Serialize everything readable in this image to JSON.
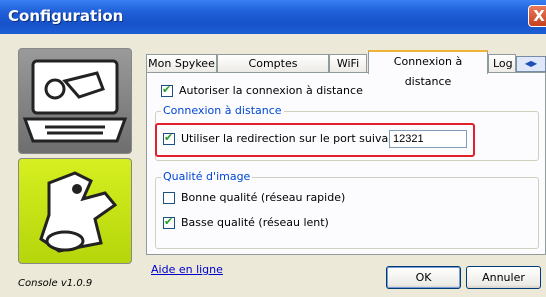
{
  "window": {
    "title": "Configuration",
    "close_glyph": "X"
  },
  "side": {
    "version": "Console v1.0.9"
  },
  "tabs": [
    {
      "label": "Mon Spykee"
    },
    {
      "label": "Comptes utilisateurs"
    },
    {
      "label": "WiFi"
    },
    {
      "label": "Connexion à distance"
    },
    {
      "label": "Log"
    }
  ],
  "tab_scroll": {
    "left": "◀",
    "right": "▶"
  },
  "panel": {
    "allow_remote_label": "Autoriser la connexion à distance",
    "remote_group_legend": "Connexion à distance",
    "redirect_label": "Utiliser la redirection sur le port suivant",
    "port_value": "12321",
    "quality_legend": "Qualité d'image",
    "good_quality_label": "Bonne qualité (réseau rapide)",
    "low_quality_label": "Basse qualité (réseau lent)"
  },
  "states": {
    "allow_remote": true,
    "redirect": true,
    "good_quality": false,
    "low_quality": true
  },
  "footer": {
    "help_link": "Aide en ligne",
    "ok": "OK",
    "cancel": "Annuler"
  }
}
